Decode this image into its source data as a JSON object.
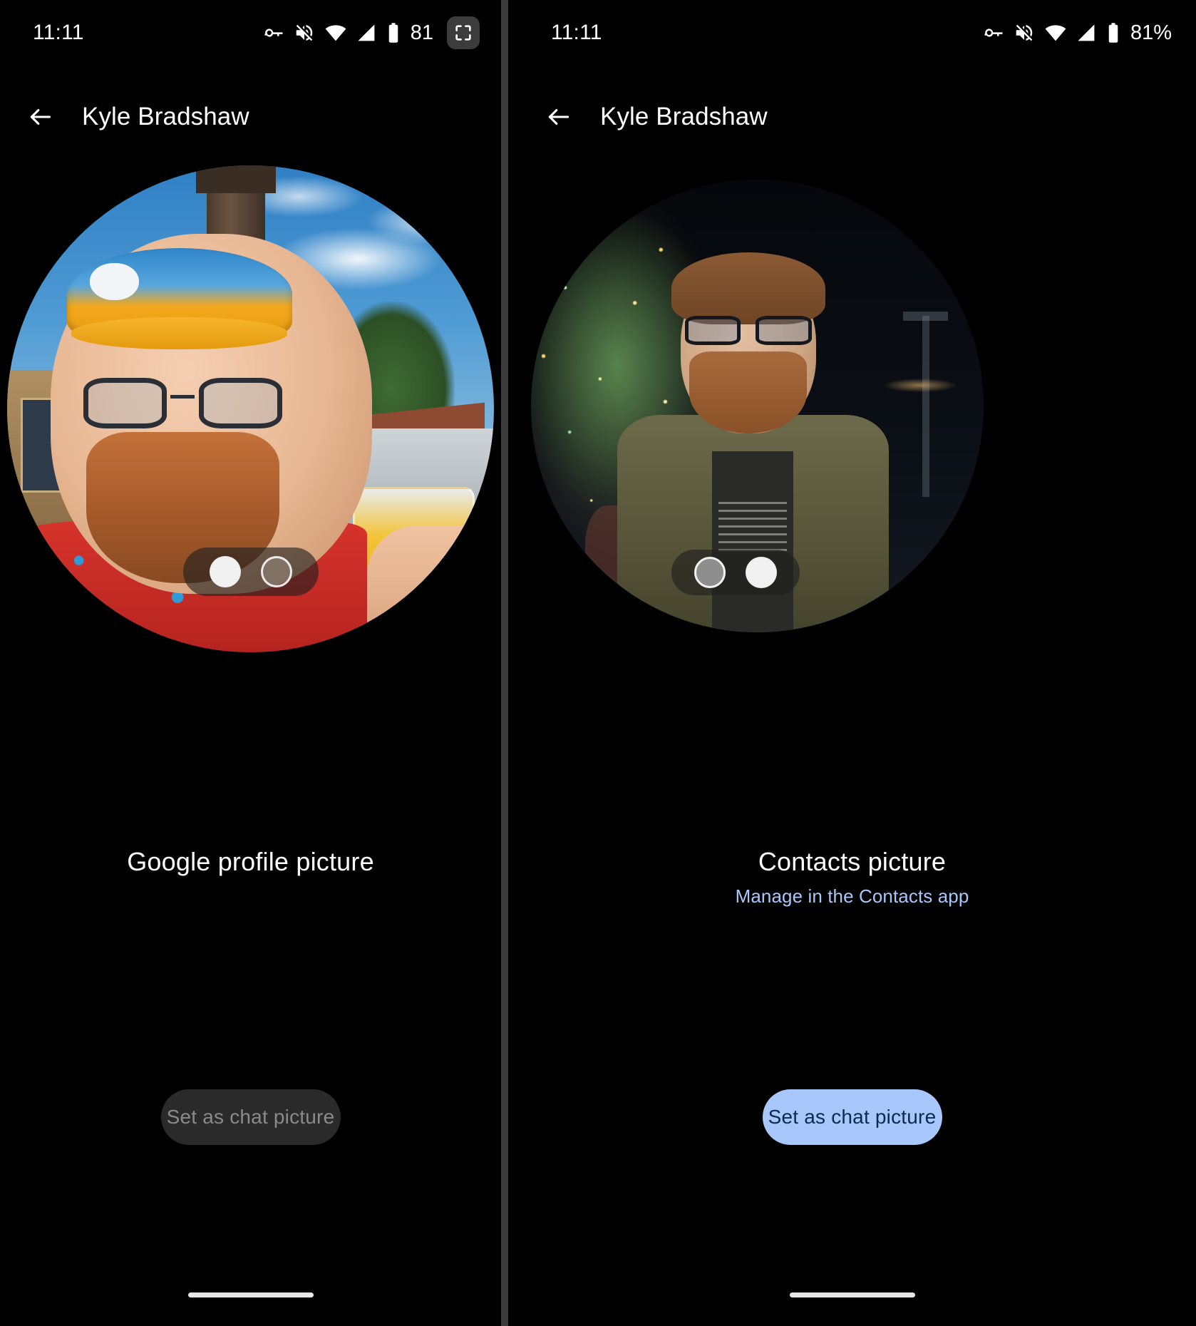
{
  "screens": [
    {
      "id": "google-profile-picture",
      "status_bar": {
        "clock": "11:11",
        "battery_level": "81",
        "icons": [
          "vpn-key-icon",
          "volume-off-icon",
          "wifi-icon",
          "cell-signal-icon",
          "battery-icon"
        ],
        "screenshot_button_icon": "fullscreen-crop-icon"
      },
      "app_bar": {
        "back_icon": "back-arrow-icon",
        "title": "Kyle Bradshaw"
      },
      "avatar": {
        "alt": "Man wearing an orange visor cap and glasses holding a beer at a theme park"
      },
      "pager": {
        "count": 2,
        "active_index": 0,
        "dot_styles": [
          "filled-white",
          "hollow"
        ]
      },
      "caption": {
        "title": "Google profile picture",
        "link": null
      },
      "cta": {
        "label": "Set as chat picture",
        "enabled": false
      },
      "home_indicator": true
    },
    {
      "id": "contacts-picture",
      "status_bar": {
        "clock": "11:11",
        "battery_level": "81%",
        "icons": [
          "vpn-key-icon",
          "volume-off-icon",
          "wifi-icon",
          "cell-signal-icon",
          "battery-icon"
        ],
        "screenshot_button_icon": null
      },
      "app_bar": {
        "back_icon": "back-arrow-icon",
        "title": "Kyle Bradshaw"
      },
      "avatar": {
        "alt": "Man in an olive jacket standing in front of a lit Christmas tree at night"
      },
      "pager": {
        "count": 2,
        "active_index": 1,
        "dot_styles": [
          "filled-gray",
          "filled-white"
        ]
      },
      "caption": {
        "title": "Contacts picture",
        "link": "Manage in the Contacts app"
      },
      "cta": {
        "label": "Set as chat picture",
        "enabled": true
      },
      "home_indicator": true
    }
  ],
  "colors": {
    "background": "#000000",
    "text_primary": "#ffffff",
    "link": "#a8c7fa",
    "cta_enabled_bg": "#a8c7fa",
    "cta_enabled_text": "#0b2a52",
    "cta_disabled_bg": "#2a2a2a",
    "cta_disabled_text": "#8a8a8a",
    "divider": "#3a3a3a"
  }
}
